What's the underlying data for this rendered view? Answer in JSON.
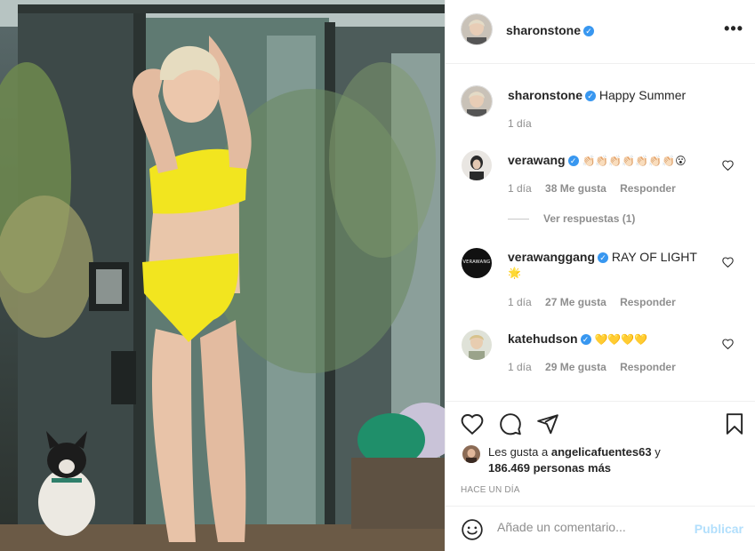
{
  "post": {
    "author": "sharonstone",
    "more_label": "•••"
  },
  "caption": {
    "user": "sharonstone",
    "text": "Happy Summer",
    "time": "1 día"
  },
  "comments": [
    {
      "user": "verawang",
      "text": "👏🏻👏🏻👏🏻👏🏻👏🏻👏🏻👏🏻😮",
      "time": "1 día",
      "likes": "38 Me gusta",
      "reply": "Responder",
      "view_replies": "Ver respuestas (1)"
    },
    {
      "user": "verawanggang",
      "text": "RAY OF LIGHT",
      "text_line2": "🌟",
      "time": "1 día",
      "likes": "27 Me gusta",
      "reply": "Responder",
      "avatar_text": "VERAWANG"
    },
    {
      "user": "katehudson",
      "text": "💛💛💛💛",
      "time": "1 día",
      "likes": "29 Me gusta",
      "reply": "Responder"
    }
  ],
  "likes": {
    "prefix": "Les gusta a",
    "user": "angelicafuentes63",
    "conj": "y",
    "others": "186.469 personas más"
  },
  "timestamp": "HACE UN DÍA",
  "add_comment": {
    "placeholder": "Añade un comentario...",
    "publish": "Publicar"
  },
  "colors": {
    "verified": "#3897f0",
    "publish_disabled": "#b2dffc",
    "swimsuit": "#f2e51f"
  }
}
